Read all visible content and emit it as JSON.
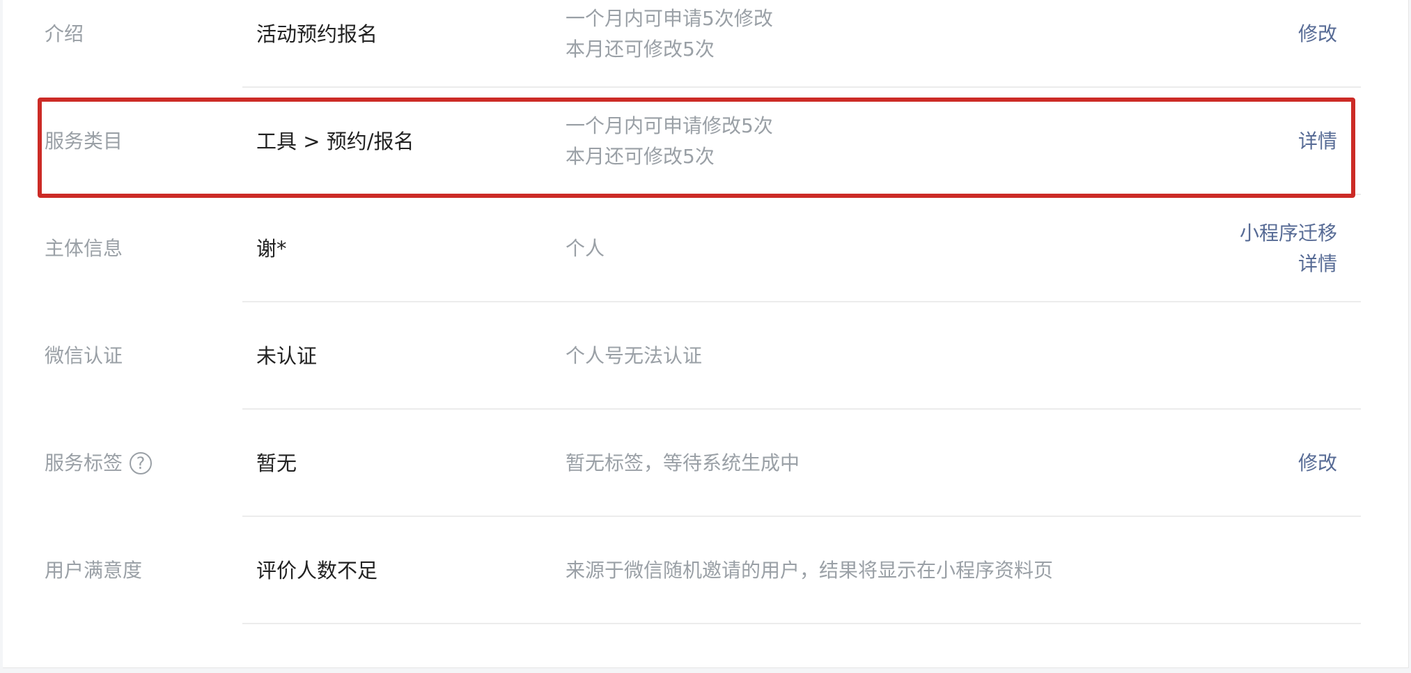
{
  "rows": [
    {
      "label": "介绍",
      "value": "活动预约报名",
      "desc": [
        "一个月内可申请5次修改",
        "本月还可修改5次"
      ],
      "actions": [
        "修改"
      ]
    },
    {
      "label": "服务类目",
      "value": "工具 > 预约/报名",
      "desc": [
        "一个月内可申请修改5次",
        "本月还可修改5次"
      ],
      "actions": [
        "详情"
      ]
    },
    {
      "label": "主体信息",
      "value": "谢*",
      "desc": [
        "个人"
      ],
      "actions": [
        "小程序迁移",
        "详情"
      ]
    },
    {
      "label": "微信认证",
      "value": "未认证",
      "desc": [
        "个人号无法认证"
      ],
      "actions": []
    },
    {
      "label": "服务标签",
      "help_icon": "?",
      "value": "暂无",
      "desc": [
        "暂无标签，等待系统生成中"
      ],
      "actions": [
        "修改"
      ]
    },
    {
      "label": "用户满意度",
      "value": "评价人数不足",
      "desc": [
        "来源于微信随机邀请的用户，结果将显示在小程序资料页"
      ],
      "actions": []
    }
  ],
  "colors": {
    "link": "#576b95",
    "label": "#9aa0a6",
    "value": "#222222",
    "highlight": "#cc2b26"
  },
  "icons": {
    "help": "question-circle-icon"
  }
}
